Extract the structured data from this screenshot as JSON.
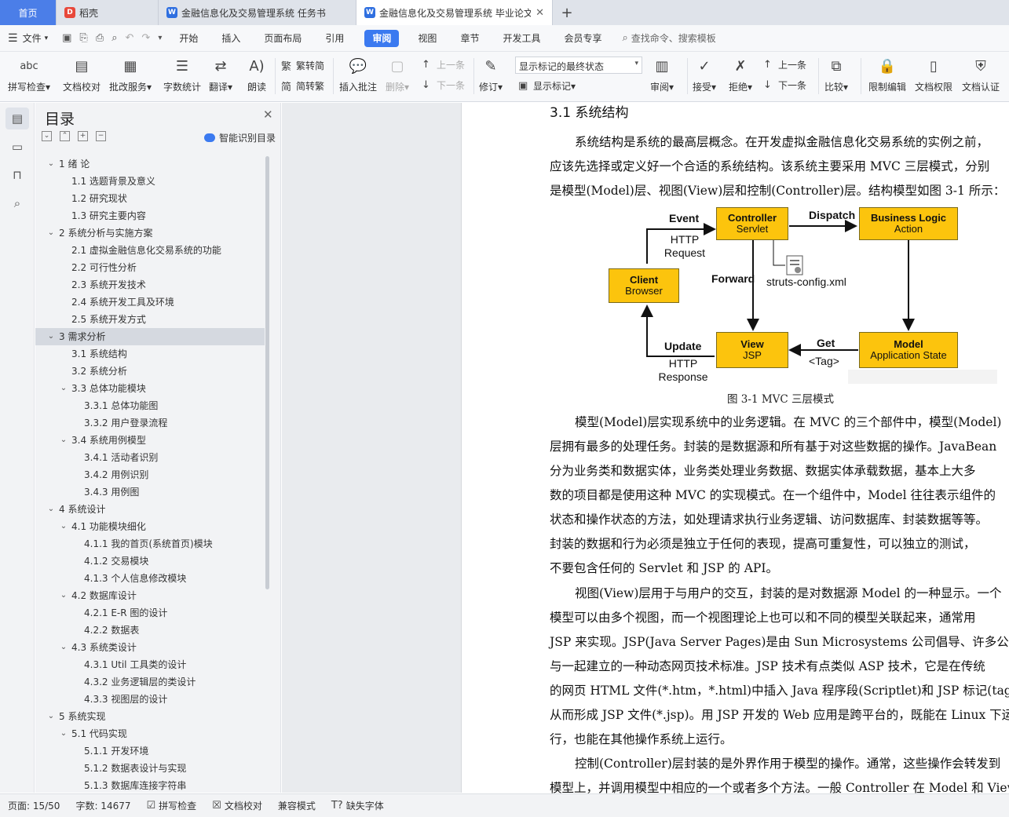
{
  "tabs": {
    "home": "首页",
    "daoke": "稻壳",
    "doc1": "金融信息化及交易管理系统 任务书",
    "doc2": "金融信息化及交易管理系统 毕业论文"
  },
  "menu": {
    "file": "文件",
    "items": [
      "开始",
      "插入",
      "页面布局",
      "引用",
      "审阅",
      "视图",
      "章节",
      "开发工具",
      "会员专享"
    ],
    "search": "查找命令、搜索模板"
  },
  "ribbon": {
    "spell": "拼写检查",
    "proof": "文档校对",
    "batch": "批改服务",
    "count": "字数统计",
    "translate": "翻译",
    "read": "朗读",
    "trad": "繁转简",
    "simp": "简转繁",
    "comment": "插入批注",
    "delete": "删除",
    "prev1": "上一条",
    "next1": "下一条",
    "revise": "修订",
    "markup_state": "显示标记的最终状态",
    "show_markup": "显示标记",
    "review": "审阅",
    "accept": "接受",
    "reject": "拒绝",
    "prev2": "上一条",
    "next2": "下一条",
    "compare": "比较",
    "restrict": "限制编辑",
    "perm": "文档权限",
    "auth": "文档认证"
  },
  "toc": {
    "title": "目录",
    "smart": "智能识别目录",
    "items": [
      {
        "text": "1  绪  论",
        "level": 1
      },
      {
        "text": "1.1  选题背景及意义",
        "level": 2
      },
      {
        "text": "1.2  研究现状",
        "level": 2
      },
      {
        "text": "1.3  研究主要内容",
        "level": 2
      },
      {
        "text": "2  系统分析与实施方案",
        "level": 1
      },
      {
        "text": "2.1  虚拟金融信息化交易系统的功能",
        "level": 2
      },
      {
        "text": "2.2  可行性分析",
        "level": 2
      },
      {
        "text": "2.3  系统开发技术",
        "level": 2
      },
      {
        "text": "2.4  系统开发工具及环境",
        "level": 2
      },
      {
        "text": "2.5  系统开发方式",
        "level": 2
      },
      {
        "text": "3  需求分析",
        "level": 1
      },
      {
        "text": "3.1  系统结构",
        "level": 2
      },
      {
        "text": "3.2  系统分析",
        "level": 2
      },
      {
        "text": "3.3  总体功能模块",
        "level": 2
      },
      {
        "text": "3.3.1  总体功能图",
        "level": 3
      },
      {
        "text": "3.3.2  用户登录流程",
        "level": 3
      },
      {
        "text": "3.4  系统用例模型",
        "level": 2
      },
      {
        "text": "3.4.1  活动者识别",
        "level": 3
      },
      {
        "text": "3.4.2  用例识别",
        "level": 3
      },
      {
        "text": "3.4.3  用例图",
        "level": 3
      },
      {
        "text": "4  系统设计",
        "level": 1
      },
      {
        "text": "4.1  功能模块细化",
        "level": 2
      },
      {
        "text": "4.1.1  我的首页(系统首页)模块",
        "level": 3
      },
      {
        "text": "4.1.2  交易模块",
        "level": 3
      },
      {
        "text": "4.1.3  个人信息修改模块",
        "level": 3
      },
      {
        "text": "4.2  数据库设计",
        "level": 2
      },
      {
        "text": "4.2.1 E-R 图的设计",
        "level": 3
      },
      {
        "text": "4.2.2  数据表",
        "level": 3
      },
      {
        "text": "4.3  系统类设计",
        "level": 2
      },
      {
        "text": "4.3.1 Util 工具类的设计",
        "level": 3
      },
      {
        "text": "4.3.2  业务逻辑层的类设计",
        "level": 3
      },
      {
        "text": "4.3.3  视图层的设计",
        "level": 3
      },
      {
        "text": "5  系统实现",
        "level": 1
      },
      {
        "text": "5.1 代码实现",
        "level": 2
      },
      {
        "text": "5.1.1 开发环境",
        "level": 3
      },
      {
        "text": "5.1.2  数据表设计与实现",
        "level": 3
      },
      {
        "text": "5.1.3  数据库连接字符串",
        "level": 3
      }
    ]
  },
  "document": {
    "heading": "3.1  系统结构",
    "para1": [
      "系统结构是系统的最高层概念。在开发虚拟金融信息化交易系统的实例之前，",
      "应该先选择或定义好一个合适的系统结构。该系统主要采用 MVC 三层模式，分别",
      "是模型(Model)层、视图(View)层和控制(Controller)层。结构模型如图 3-1 所示："
    ],
    "caption": "图 3-1    MVC 三层模式",
    "para2": [
      "模型(Model)层实现系统中的业务逻辑。在 MVC 的三个部件中，模型(Model)",
      "层拥有最多的处理任务。封装的是数据源和所有基于对这些数据的操作。JavaBean",
      "分为业务类和数据实体，业务类处理业务数据、数据实体承载数据，基本上大多",
      "数的项目都是使用这种 MVC 的实现模式。在一个组件中，Model 往往表示组件的",
      "状态和操作状态的方法，如处理请求执行业务逻辑、访问数据库、封装数据等等。",
      "封装的数据和行为必须是独立于任何的表现，提高可重复性，可以独立的测试，",
      "不要包含任何的 Servlet 和 JSP 的 API。"
    ],
    "para3": [
      "视图(View)层用于与用户的交互，封装的是对数据源 Model 的一种显示。一个",
      "模型可以由多个视图，而一个视图理论上也可以和不同的模型关联起来，通常用",
      "JSP 来实现。JSP(Java Server Pages)是由 Sun Microsystems 公司倡导、许多公司参",
      "与一起建立的一种动态网页技术标准。JSP 技术有点类似 ASP 技术，它是在传统",
      "的网页 HTML 文件(*.htm，*.html)中插入 Java 程序段(Scriptlet)和 JSP 标记(tag)，",
      "从而形成 JSP 文件(*.jsp)。用 JSP 开发的 Web 应用是跨平台的，既能在 Linux 下运",
      "行，也能在其他操作系统上运行。"
    ],
    "para4": [
      "控制(Controller)层封装的是外界作用于模型的操作。通常，这些操作会转发到",
      "模型上，并调用模型中相应的一个或者多个方法。一般 Controller 在 Model 和 View"
    ]
  },
  "diagram": {
    "controller": [
      "Controller",
      "Servlet"
    ],
    "business": [
      "Business Logic",
      "Action"
    ],
    "client": [
      "Client",
      "Browser"
    ],
    "view": [
      "View",
      "JSP"
    ],
    "model": [
      "Model",
      "Application State"
    ],
    "event": "Event",
    "http_request": [
      "HTTP",
      "Request"
    ],
    "dispatch": "Dispatch",
    "forward": "Forward",
    "struts": "struts-config.xml",
    "update": "Update",
    "http_response": [
      "HTTP",
      "Response"
    ],
    "get": "Get",
    "tag": "<Tag>"
  },
  "status": {
    "page": "页面: 15/50",
    "words": "字数: 14677",
    "spell": "拼写检查",
    "proof": "文档校对",
    "compat": "兼容模式",
    "missing_font": "缺失字体"
  }
}
